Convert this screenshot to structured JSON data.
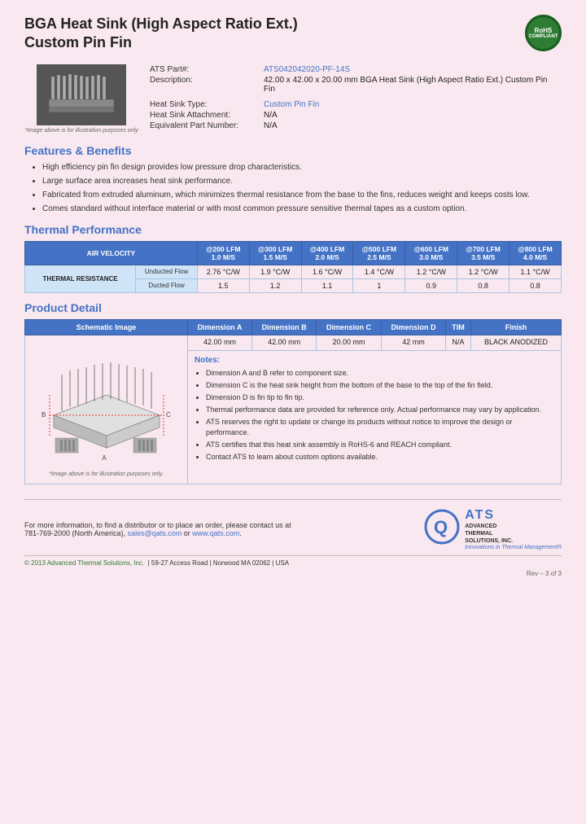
{
  "page": {
    "title_line1": "BGA Heat Sink (High Aspect Ratio Ext.)",
    "title_line2": "Custom Pin Fin",
    "image_caption": "*Image above is for illustration purposes only"
  },
  "specs": {
    "part_label": "ATS Part#:",
    "part_value": "ATS042042020-PF-14S",
    "desc_label": "Description:",
    "desc_value": "42.00 x 42.00 x 20.00 mm  BGA Heat Sink (High Aspect Ratio Ext.) Custom Pin Fin",
    "type_label": "Heat Sink Type:",
    "type_value": "Custom Pin Fin",
    "attach_label": "Heat Sink Attachment:",
    "attach_value": "N/A",
    "equiv_label": "Equivalent Part Number:",
    "equiv_value": "N/A"
  },
  "rohs": {
    "line1": "RoHS",
    "line2": "COMPLIANT"
  },
  "features": {
    "heading": "Features & Benefits",
    "items": [
      "High efficiency pin fin design provides low pressure drop characteristics.",
      "Large surface area increases heat sink performance.",
      "Fabricated from extruded aluminum, which minimizes thermal resistance from the base to the fins, reduces weight and keeps costs low.",
      "Comes standard without interface material or with most common pressure sensitive thermal tapes as a custom option."
    ]
  },
  "thermal": {
    "heading": "Thermal Performance",
    "col_header": "AIR VELOCITY",
    "cols": [
      {
        "top": "@200 LFM",
        "bot": "1.0 M/S"
      },
      {
        "top": "@300 LFM",
        "bot": "1.5 M/S"
      },
      {
        "top": "@400 LFM",
        "bot": "2.0 M/S"
      },
      {
        "top": "@500 LFM",
        "bot": "2.5 M/S"
      },
      {
        "top": "@600 LFM",
        "bot": "3.0 M/S"
      },
      {
        "top": "@700 LFM",
        "bot": "3.5 M/S"
      },
      {
        "top": "@800 LFM",
        "bot": "4.0 M/S"
      }
    ],
    "row_label": "THERMAL RESISTANCE",
    "rows": [
      {
        "label": "Unducted Flow",
        "values": [
          "2.76 °C/W",
          "1.9 °C/W",
          "1.6 °C/W",
          "1.4 °C/W",
          "1.2 °C/W",
          "1.2 °C/W",
          "1.1 °C/W"
        ]
      },
      {
        "label": "Ducted Flow",
        "values": [
          "1.5",
          "1.2",
          "1.1",
          "1",
          "0.9",
          "0.8",
          "0.8"
        ]
      }
    ]
  },
  "product_detail": {
    "heading": "Product Detail",
    "columns": [
      "Schematic Image",
      "Dimension A",
      "Dimension B",
      "Dimension C",
      "Dimension D",
      "TIM",
      "Finish"
    ],
    "values": [
      "42.00 mm",
      "42.00 mm",
      "20.00 mm",
      "42 mm",
      "N/A",
      "BLACK ANODIZED"
    ],
    "schematic_caption": "*Image above is for illustration purposes only.",
    "notes_title": "Notes:",
    "notes": [
      "Dimension A and B refer to component size.",
      "Dimension C is the heat sink height from the bottom of the base to the top of the fin field.",
      "Dimension D is fin tip to fin tip.",
      "Thermal performance data are provided for reference only. Actual performance may vary by application.",
      "ATS reserves the right to update or change its products without notice to improve the design or performance.",
      "ATS certifies that this heat sink assembly is RoHS-6 and REACH compliant.",
      "Contact ATS to learn about custom options available."
    ]
  },
  "footer": {
    "contact_text": "For more information, to find a distributor or to place an order, please contact us at",
    "phone": "781-769-2000 (North America)",
    "email": "sales@qats.com",
    "website": "www.qats.com",
    "copyright": "© 2013 Advanced Thermal Solutions, Inc.",
    "address": "59-27 Access Road  |  Norwood MA  02062  |  USA",
    "page_num": "Rev – 3 of 3"
  },
  "ats_logo": {
    "q": "Q",
    "ats": "ATS",
    "full_name": "ADVANCED\nTHERMAL\nSOLUTIONS, INC.",
    "tagline": "Innovations in Thermal Management®"
  }
}
